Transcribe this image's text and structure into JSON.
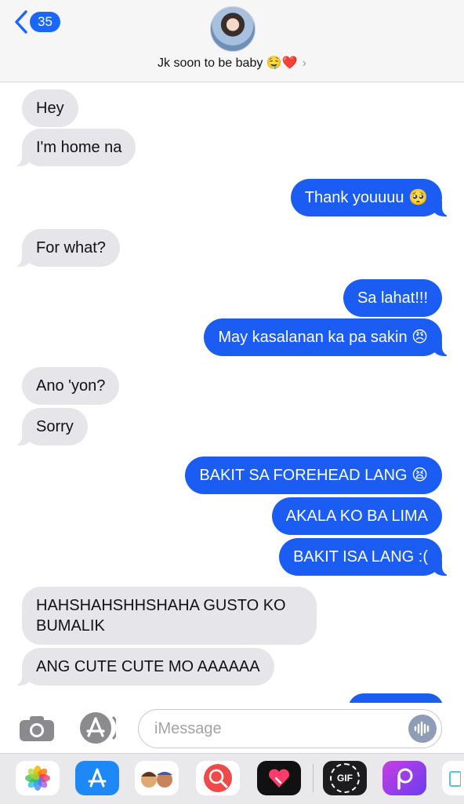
{
  "header": {
    "back_count": "35",
    "contact_name": "Jk soon to be baby 🤤❤️"
  },
  "messages": [
    {
      "dir": "recv",
      "text": "Hey"
    },
    {
      "dir": "recv",
      "text": "I'm home na"
    },
    {
      "dir": "sent",
      "text": "Thank youuuu 🥺"
    },
    {
      "dir": "recv",
      "text": "For what?"
    },
    {
      "dir": "sent",
      "text": "Sa lahat!!!"
    },
    {
      "dir": "sent",
      "text": "May kasalanan ka pa sakin 😠"
    },
    {
      "dir": "recv",
      "text": "Ano 'yon?"
    },
    {
      "dir": "recv",
      "text": "Sorry"
    },
    {
      "dir": "sent",
      "text": "BAKIT SA FOREHEAD LANG 😫"
    },
    {
      "dir": "sent",
      "text": "AKALA KO BA LIMA"
    },
    {
      "dir": "sent",
      "text": "BAKIT ISA LANG :("
    },
    {
      "dir": "recv",
      "text": "HAHSHAHSHHSHAHA GUSTO KO\nBUMALIK"
    },
    {
      "dir": "recv",
      "text": "ANG CUTE CUTE MO AAAAAA"
    }
  ],
  "input": {
    "placeholder": "iMessage"
  },
  "drawer": {
    "apps": [
      "photos-icon",
      "app-store-icon",
      "memoji-icon",
      "web-images-icon",
      "digital-touch-icon",
      "gif-icon",
      "picsart-icon",
      "notes-icon"
    ],
    "gif_label": "GIF"
  },
  "colors": {
    "sent_bubble": "#1b5cf2",
    "received_bubble": "#e6e6ea",
    "accent": "#1a66ff"
  }
}
